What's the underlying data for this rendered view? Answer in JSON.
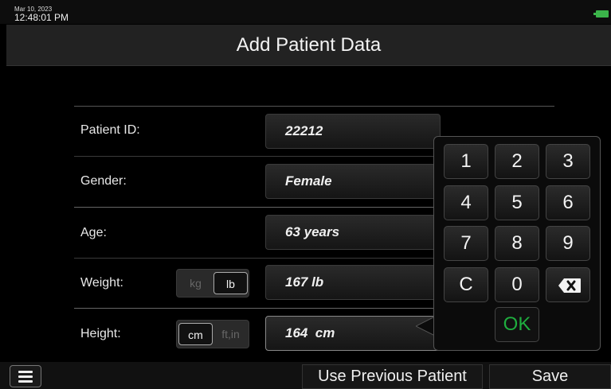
{
  "status": {
    "date": "Mar 10, 2023",
    "time": "12:48:01 PM"
  },
  "header": {
    "title": "Add Patient Data"
  },
  "form": {
    "patient_id": {
      "label": "Patient ID:",
      "value": "22212"
    },
    "gender": {
      "label": "Gender:",
      "value": "Female"
    },
    "age": {
      "label": "Age:",
      "value": "63 years"
    },
    "weight": {
      "label": "Weight:",
      "value": "167 lb",
      "units": [
        "kg",
        "lb"
      ],
      "selected_unit": "lb"
    },
    "height": {
      "label": "Height:",
      "value": "164  cm",
      "units": [
        "cm",
        "ft,in"
      ],
      "selected_unit": "cm"
    }
  },
  "keypad": {
    "keys": [
      "1",
      "2",
      "3",
      "4",
      "5",
      "6",
      "7",
      "8",
      "9",
      "C",
      "0"
    ],
    "backspace_icon": "backspace-icon",
    "ok_label": "OK",
    "ok_color": "#1fae3f"
  },
  "footer": {
    "menu_icon": "hamburger-menu-icon",
    "use_previous_label": "Use Previous Patient",
    "save_label": "Save"
  },
  "colors": {
    "battery": "#3bb44a"
  }
}
